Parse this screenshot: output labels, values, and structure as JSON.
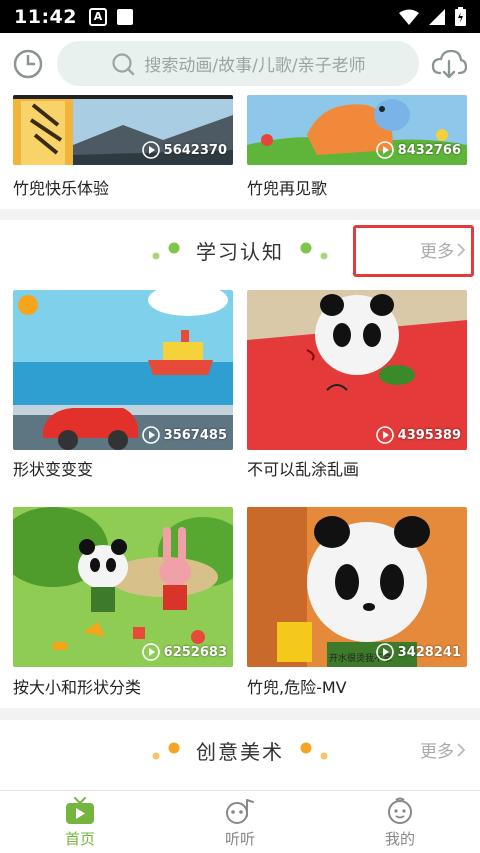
{
  "status": {
    "time": "11:42",
    "badge": "A"
  },
  "search": {
    "placeholder": "搜索动画/故事/儿歌/亲子老师"
  },
  "top_videos": [
    {
      "title": "竹兜快乐体验",
      "plays": "5642370"
    },
    {
      "title": "竹兜再见歌",
      "plays": "8432766"
    }
  ],
  "section1": {
    "title": "学习认知",
    "more": "更多",
    "dot_color": "#a8d67a",
    "videos": [
      {
        "title": "形状变变变",
        "plays": "3567485"
      },
      {
        "title": "不可以乱涂乱画",
        "plays": "4395389"
      },
      {
        "title": "按大小和形状分类",
        "plays": "6252683"
      },
      {
        "title": "竹兜,危险-MV",
        "plays": "3428241",
        "caption": "开水很烫我不拿"
      }
    ]
  },
  "section2": {
    "title": "创意美术",
    "more": "更多",
    "dot_color": "#f5a623"
  },
  "nav": {
    "items": [
      {
        "label": "首页",
        "active": true
      },
      {
        "label": "听听",
        "active": false
      },
      {
        "label": "我的",
        "active": false
      }
    ],
    "active_color": "#74b63d"
  },
  "highlight_color": "#e33b3b"
}
